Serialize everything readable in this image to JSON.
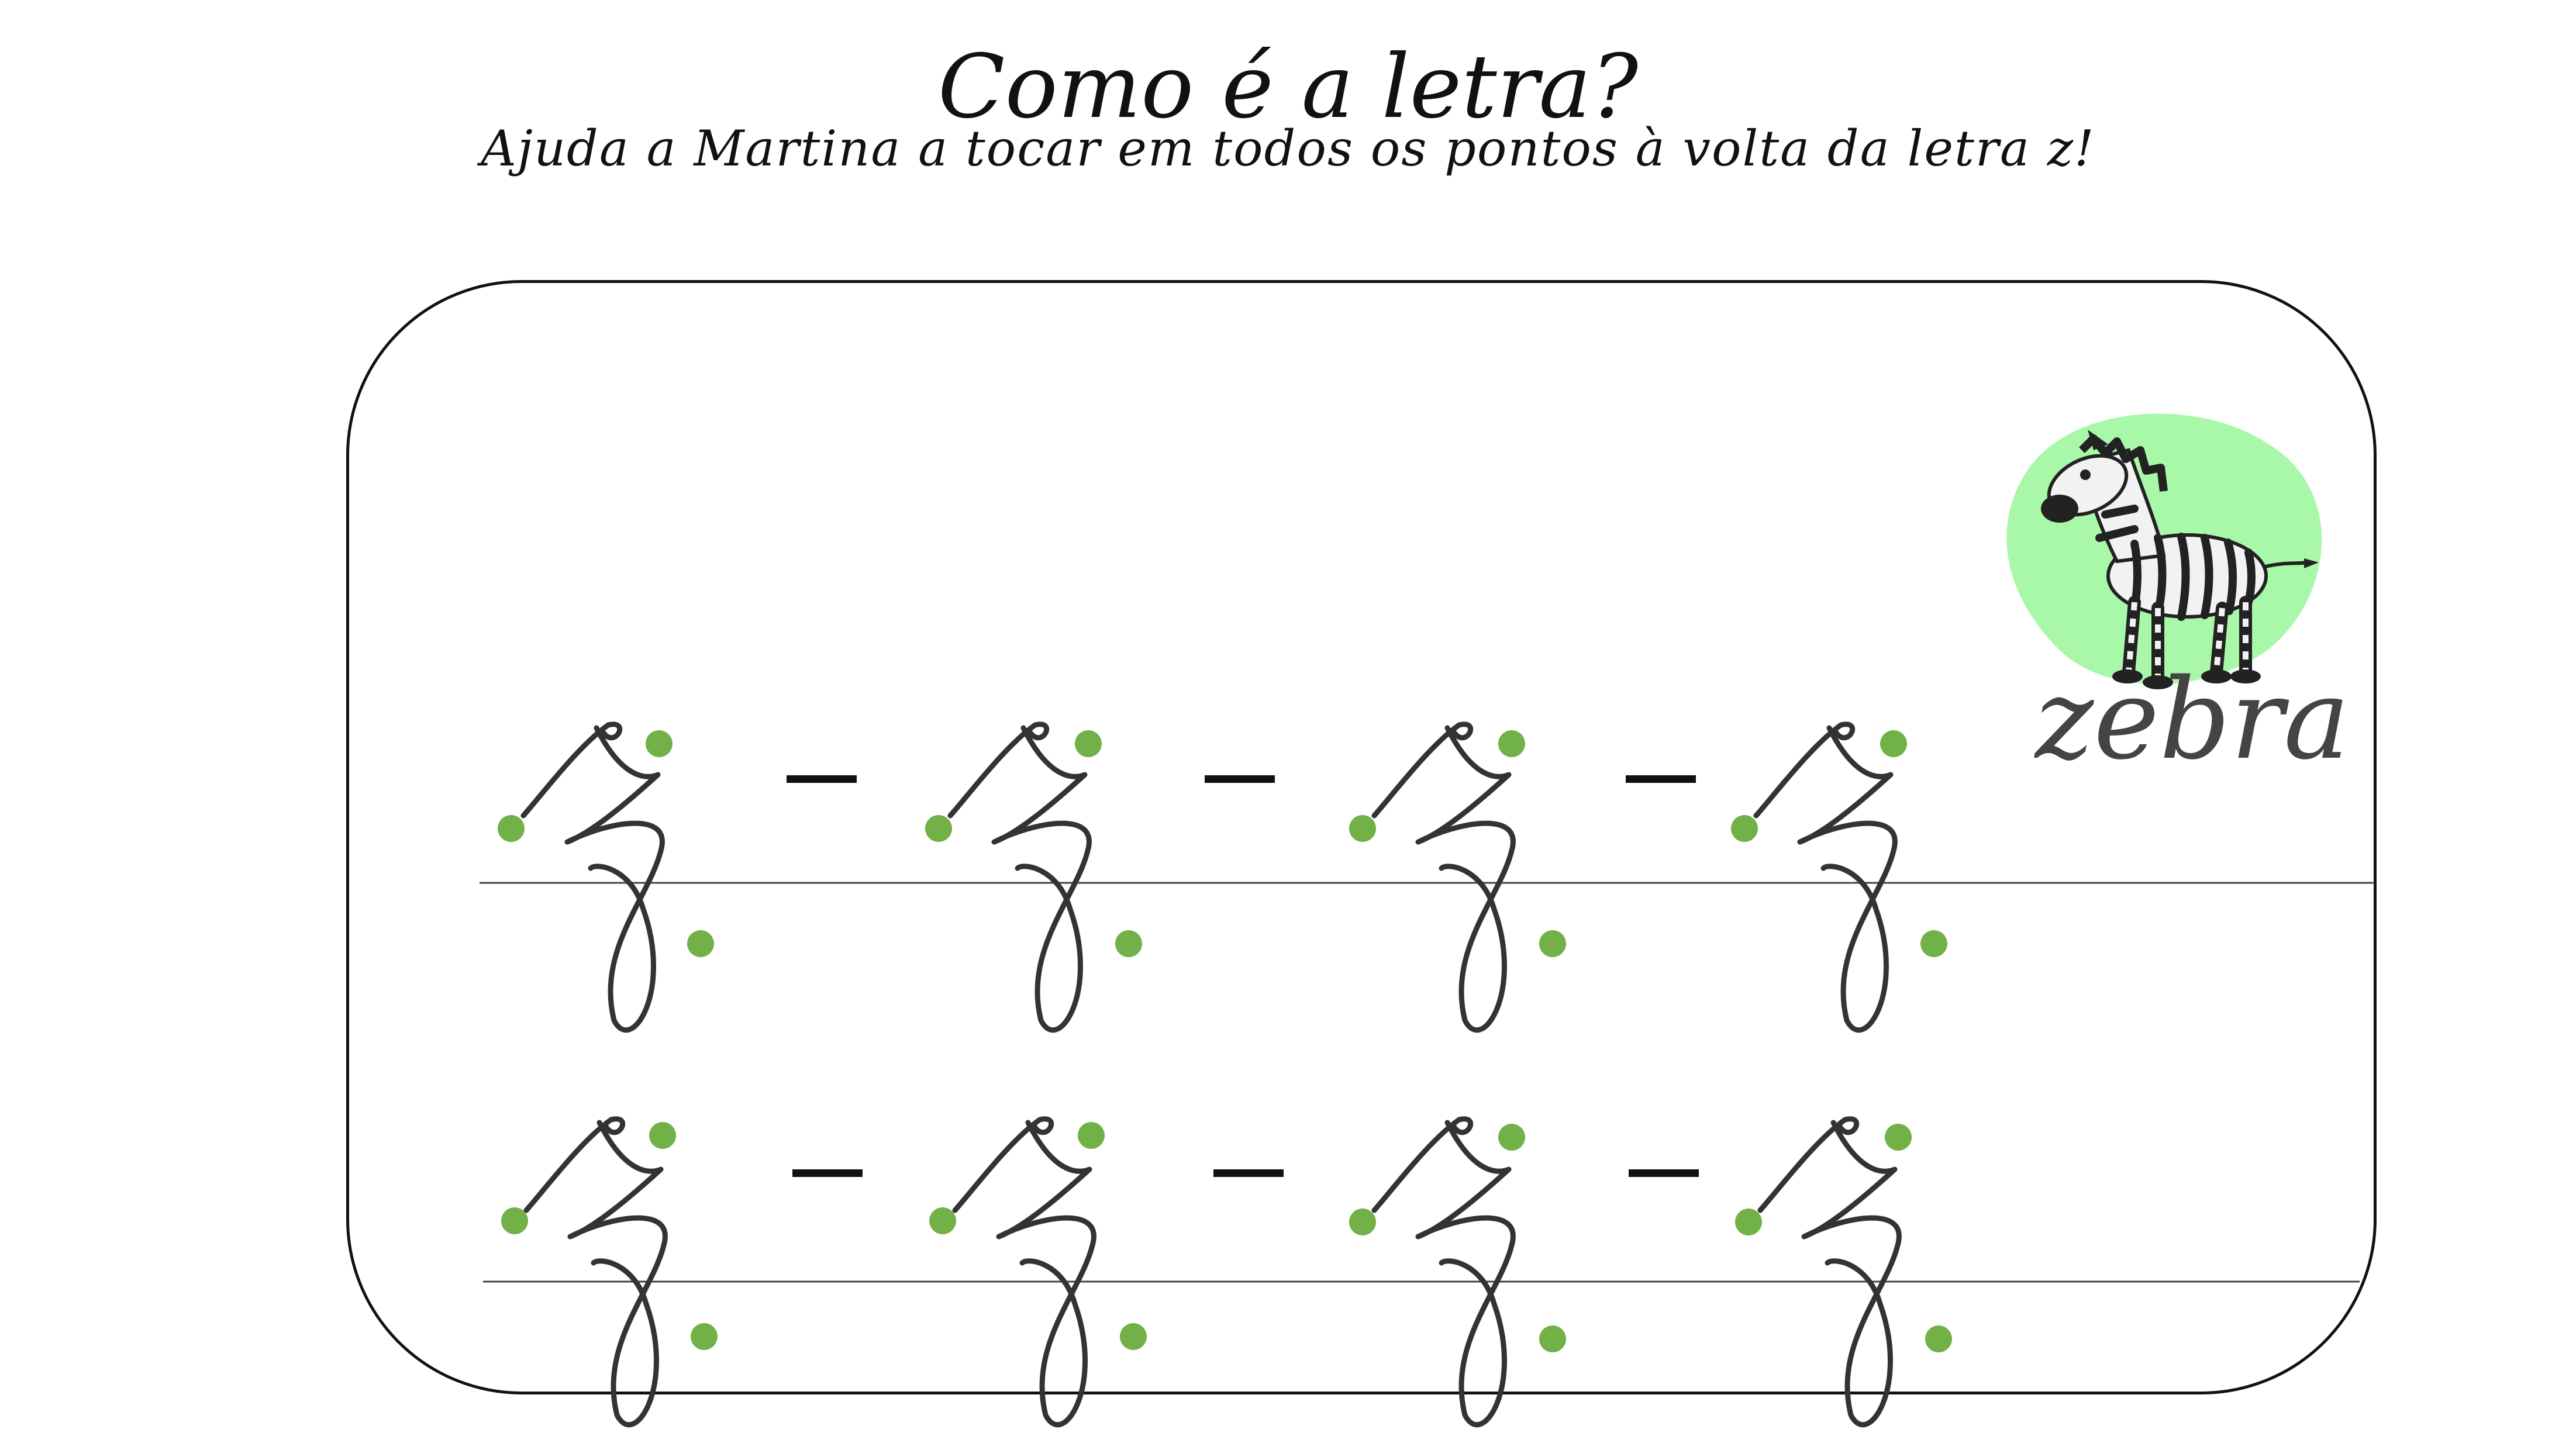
{
  "header": {
    "title": "Como é a letra?",
    "instruction": "Ajuda a Martina a tocar em todos os pontos à volta da letra z!"
  },
  "worksheet": {
    "letter": "z",
    "rows": 2,
    "letters_per_row": 4,
    "dots_per_letter": 3,
    "picture": {
      "icon": "zebra-icon",
      "word": "zebra"
    },
    "colors": {
      "dot": "#72b147",
      "blob": "#a9f7a9",
      "letter_stroke": "#333333",
      "line": "#444444"
    }
  }
}
